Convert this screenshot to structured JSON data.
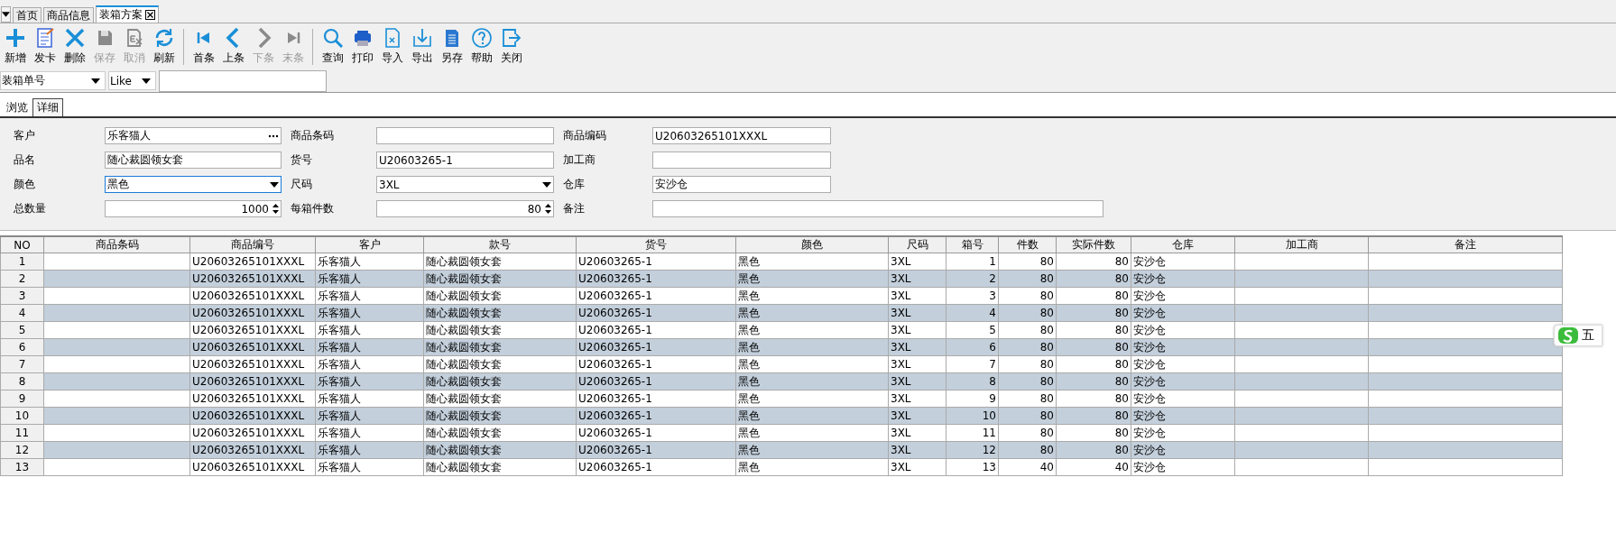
{
  "doc_tabs": [
    {
      "label": "首页",
      "selected": false,
      "closable": false
    },
    {
      "label": "商品信息",
      "selected": false,
      "closable": false
    },
    {
      "label": "装箱方案",
      "selected": true,
      "closable": true
    }
  ],
  "toolbar": {
    "groups": [
      {
        "buttons": [
          {
            "label": "新增",
            "kind": "add",
            "disabled": false
          },
          {
            "label": "发卡",
            "kind": "issue",
            "disabled": false
          },
          {
            "label": "删除",
            "kind": "delete",
            "disabled": false
          },
          {
            "label": "保存",
            "kind": "save",
            "disabled": true
          },
          {
            "label": "取消",
            "kind": "cancel",
            "disabled": true
          },
          {
            "label": "刷新",
            "kind": "refresh",
            "disabled": false
          }
        ]
      },
      {
        "buttons": [
          {
            "label": "首条",
            "kind": "first",
            "disabled": false
          },
          {
            "label": "上条",
            "kind": "prev",
            "disabled": false
          },
          {
            "label": "下条",
            "kind": "next",
            "disabled": true
          },
          {
            "label": "末条",
            "kind": "last",
            "disabled": true
          }
        ]
      },
      {
        "buttons": [
          {
            "label": "查询",
            "kind": "search",
            "disabled": false
          },
          {
            "label": "打印",
            "kind": "print",
            "disabled": false
          },
          {
            "label": "导入",
            "kind": "import",
            "disabled": false
          },
          {
            "label": "导出",
            "kind": "export",
            "disabled": false
          },
          {
            "label": "另存",
            "kind": "saveas",
            "disabled": false
          },
          {
            "label": "帮助",
            "kind": "help",
            "disabled": false
          },
          {
            "label": "关闭",
            "kind": "close",
            "disabled": false
          }
        ]
      }
    ]
  },
  "filter": {
    "field": "装箱单号",
    "operator": "Like"
  },
  "view_tabs": [
    {
      "label": "浏览",
      "selected": false
    },
    {
      "label": "详细",
      "selected": true
    }
  ],
  "form": {
    "rows": [
      {
        "fields": [
          {
            "label": "客户",
            "value": "乐客猫人",
            "kind": "lookup",
            "focused": false,
            "wide": false
          },
          {
            "label": "商品条码",
            "kind": "text",
            "focused": false,
            "wide": false
          },
          {
            "label": "商品编码",
            "value": "U20603265101XXXL",
            "kind": "text",
            "focused": false,
            "wide": false
          }
        ]
      },
      {
        "fields": [
          {
            "label": "品名",
            "value": "随心裁圆领女套",
            "kind": "text",
            "focused": false,
            "wide": false
          },
          {
            "label": "货号",
            "value": "U20603265-1",
            "kind": "text",
            "focused": false,
            "wide": false
          },
          {
            "label": "加工商",
            "kind": "text",
            "focused": false,
            "wide": false
          }
        ]
      },
      {
        "fields": [
          {
            "label": "颜色",
            "value": "黑色",
            "kind": "combo",
            "focused": true,
            "wide": false
          },
          {
            "label": "尺码",
            "value": "3XL",
            "kind": "combo",
            "focused": false,
            "wide": false
          },
          {
            "label": "仓库",
            "value": "安沙仓",
            "kind": "text",
            "focused": false,
            "wide": false
          }
        ]
      },
      {
        "fields": [
          {
            "label": "总数量",
            "value": "1000",
            "kind": "spin",
            "focused": false,
            "wide": false
          },
          {
            "label": "每箱件数",
            "value": "80",
            "kind": "spin",
            "focused": false,
            "wide": false
          },
          {
            "label": "备注",
            "kind": "text",
            "focused": false,
            "wide": true
          }
        ]
      }
    ]
  },
  "table": {
    "columns": [
      {
        "label": "NO",
        "kind": "index"
      },
      {
        "label": "商品条码",
        "kind": "text"
      },
      {
        "label": "商品编号",
        "kind": "text"
      },
      {
        "label": "客户",
        "kind": "text"
      },
      {
        "label": "款号",
        "kind": "text"
      },
      {
        "label": "货号",
        "kind": "text"
      },
      {
        "label": "颜色",
        "kind": "text"
      },
      {
        "label": "尺码",
        "kind": "text"
      },
      {
        "label": "箱号",
        "kind": "number"
      },
      {
        "label": "件数",
        "kind": "number"
      },
      {
        "label": "实际件数",
        "kind": "number"
      },
      {
        "label": "仓库",
        "kind": "text"
      },
      {
        "label": "加工商",
        "kind": "text"
      },
      {
        "label": "备注",
        "kind": "text"
      }
    ],
    "rows": [
      {
        "cells": [
          "1",
          null,
          "U20603265101XXXL",
          "乐客猫人",
          "随心裁圆领女套",
          "U20603265-1",
          "黑色",
          "3XL",
          "1",
          "80",
          "80",
          "安沙仓",
          null,
          null
        ]
      },
      {
        "cells": [
          "2",
          null,
          "U20603265101XXXL",
          "乐客猫人",
          "随心裁圆领女套",
          "U20603265-1",
          "黑色",
          "3XL",
          "2",
          "80",
          "80",
          "安沙仓",
          null,
          null
        ]
      },
      {
        "cells": [
          "3",
          null,
          "U20603265101XXXL",
          "乐客猫人",
          "随心裁圆领女套",
          "U20603265-1",
          "黑色",
          "3XL",
          "3",
          "80",
          "80",
          "安沙仓",
          null,
          null
        ]
      },
      {
        "cells": [
          "4",
          null,
          "U20603265101XXXL",
          "乐客猫人",
          "随心裁圆领女套",
          "U20603265-1",
          "黑色",
          "3XL",
          "4",
          "80",
          "80",
          "安沙仓",
          null,
          null
        ]
      },
      {
        "cells": [
          "5",
          null,
          "U20603265101XXXL",
          "乐客猫人",
          "随心裁圆领女套",
          "U20603265-1",
          "黑色",
          "3XL",
          "5",
          "80",
          "80",
          "安沙仓",
          null,
          null
        ]
      },
      {
        "cells": [
          "6",
          null,
          "U20603265101XXXL",
          "乐客猫人",
          "随心裁圆领女套",
          "U20603265-1",
          "黑色",
          "3XL",
          "6",
          "80",
          "80",
          "安沙仓",
          null,
          null
        ]
      },
      {
        "cells": [
          "7",
          null,
          "U20603265101XXXL",
          "乐客猫人",
          "随心裁圆领女套",
          "U20603265-1",
          "黑色",
          "3XL",
          "7",
          "80",
          "80",
          "安沙仓",
          null,
          null
        ]
      },
      {
        "cells": [
          "8",
          null,
          "U20603265101XXXL",
          "乐客猫人",
          "随心裁圆领女套",
          "U20603265-1",
          "黑色",
          "3XL",
          "8",
          "80",
          "80",
          "安沙仓",
          null,
          null
        ]
      },
      {
        "cells": [
          "9",
          null,
          "U20603265101XXXL",
          "乐客猫人",
          "随心裁圆领女套",
          "U20603265-1",
          "黑色",
          "3XL",
          "9",
          "80",
          "80",
          "安沙仓",
          null,
          null
        ]
      },
      {
        "cells": [
          "10",
          null,
          "U20603265101XXXL",
          "乐客猫人",
          "随心裁圆领女套",
          "U20603265-1",
          "黑色",
          "3XL",
          "10",
          "80",
          "80",
          "安沙仓",
          null,
          null
        ]
      },
      {
        "cells": [
          "11",
          null,
          "U20603265101XXXL",
          "乐客猫人",
          "随心裁圆领女套",
          "U20603265-1",
          "黑色",
          "3XL",
          "11",
          "80",
          "80",
          "安沙仓",
          null,
          null
        ]
      },
      {
        "cells": [
          "12",
          null,
          "U20603265101XXXL",
          "乐客猫人",
          "随心裁圆领女套",
          "U20603265-1",
          "黑色",
          "3XL",
          "12",
          "80",
          "80",
          "安沙仓",
          null,
          null
        ]
      },
      {
        "cells": [
          "13",
          null,
          "U20603265101XXXL",
          "乐客猫人",
          "随心裁圆领女套",
          "U20603265-1",
          "黑色",
          "3XL",
          "13",
          "40",
          "40",
          "安沙仓",
          null,
          null
        ]
      }
    ]
  },
  "ime_status": {
    "label": "五"
  }
}
